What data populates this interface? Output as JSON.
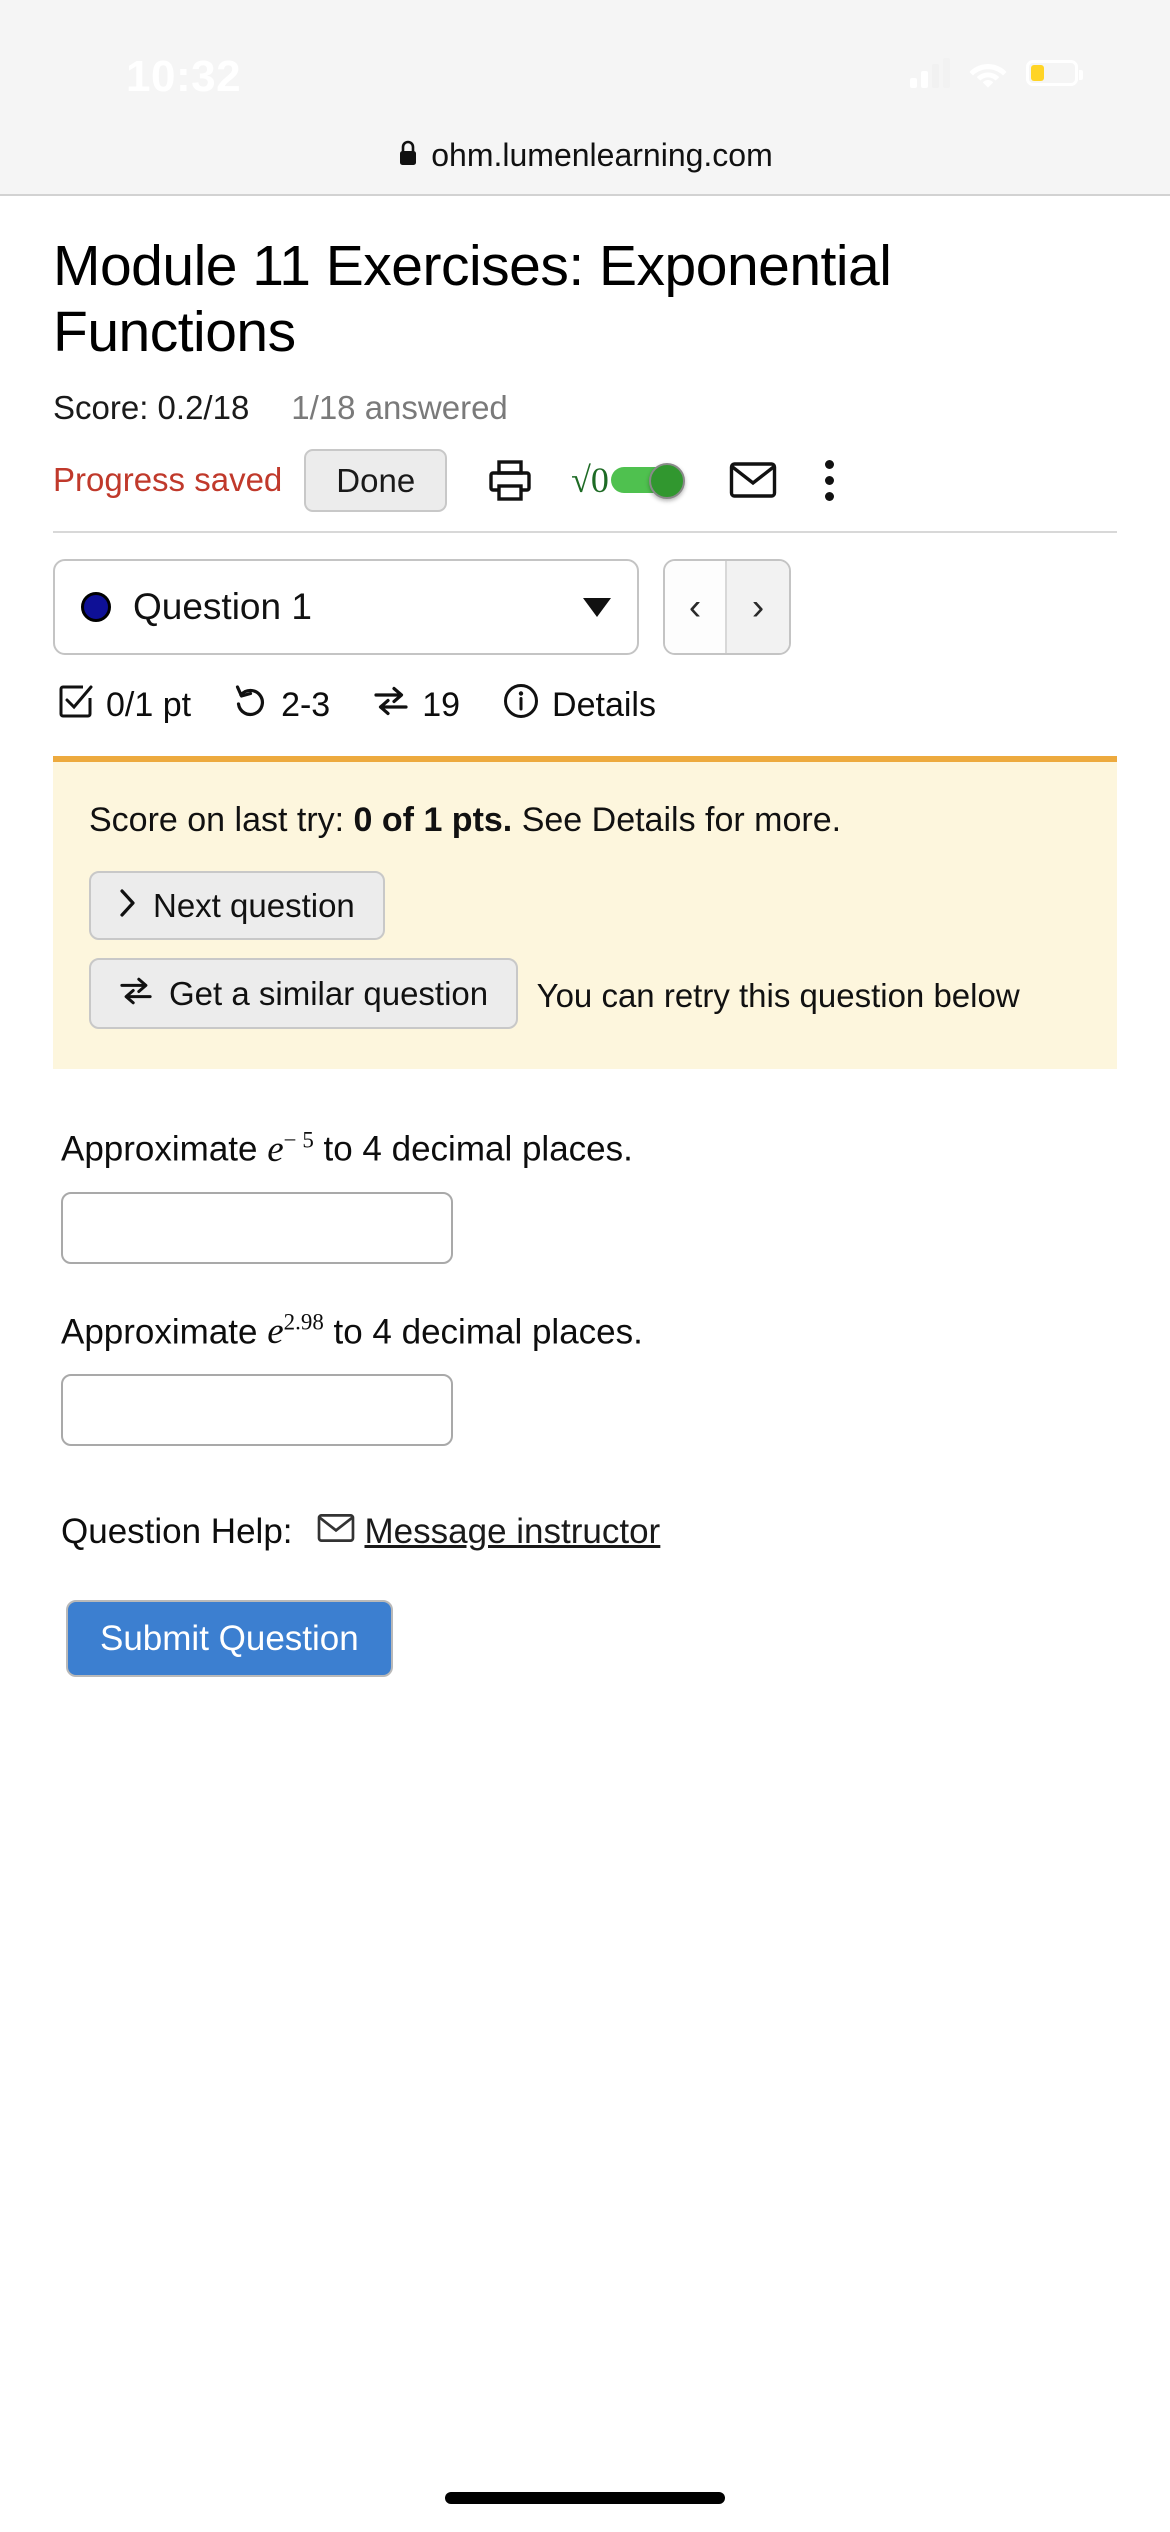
{
  "status_bar": {
    "time": "10:32",
    "signal_icon": "cellular-signal-icon",
    "wifi_icon": "wifi-icon",
    "battery_icon": "battery-icon",
    "battery_color": "#ffd426"
  },
  "browser": {
    "lock_icon": "lock-icon",
    "url": "ohm.lumenlearning.com"
  },
  "page": {
    "title": "Module 11 Exercises: Exponential Functions",
    "score_text": "Score: 0.2/18",
    "answered_text": "1/18 answered"
  },
  "toolbar": {
    "progress_saved": "Progress saved",
    "done_label": "Done",
    "print_icon": "printer-icon",
    "math_label": "√0",
    "math_toggle_icon": "math-keyboard-toggle",
    "math_toggle_state": "on",
    "math_toggle_color": "#4fc14f",
    "mail_icon": "envelope-icon",
    "kebab_icon": "more-vertical-icon"
  },
  "question_nav": {
    "dot_color": "#0e1096",
    "selected_question": "Question 1",
    "caret_icon": "chevron-down-icon",
    "prev_label": "‹",
    "next_label": "›"
  },
  "question_status": {
    "check_icon": "checkbox-checked-icon",
    "points": "0/1 pt",
    "attempts_icon": "undo-attempts-icon",
    "attempts": "2-3",
    "similar_icon": "swap-arrows-icon",
    "similar_count": "19",
    "info_icon": "info-circle-icon",
    "details_label": "Details"
  },
  "alert": {
    "border_color": "#edaa3e",
    "background_color": "#fdf6dd",
    "message_prefix": "Score on last try: ",
    "message_bold": "0 of 1 pts.",
    "message_suffix": " See Details for more.",
    "next_question_icon": "chevron-right-icon",
    "next_question_label": "Next question",
    "similar_question_icon": "swap-arrows-icon",
    "similar_question_label": "Get a similar question",
    "retry_text": "You can retry this question below"
  },
  "questions": [
    {
      "prefix": "Approximate ",
      "base": "e",
      "exponent": "− 5",
      "suffix": " to 4 decimal places.",
      "value": "",
      "placeholder": ""
    },
    {
      "prefix": "Approximate ",
      "base": "e",
      "exponent": "2.98",
      "suffix": " to 4 decimal places.",
      "value": "",
      "placeholder": ""
    }
  ],
  "help": {
    "label": "Question Help:",
    "mail_icon": "envelope-icon",
    "link_text": "Message instructor"
  },
  "submit": {
    "label": "Submit Question",
    "color": "#3c7fd0"
  }
}
